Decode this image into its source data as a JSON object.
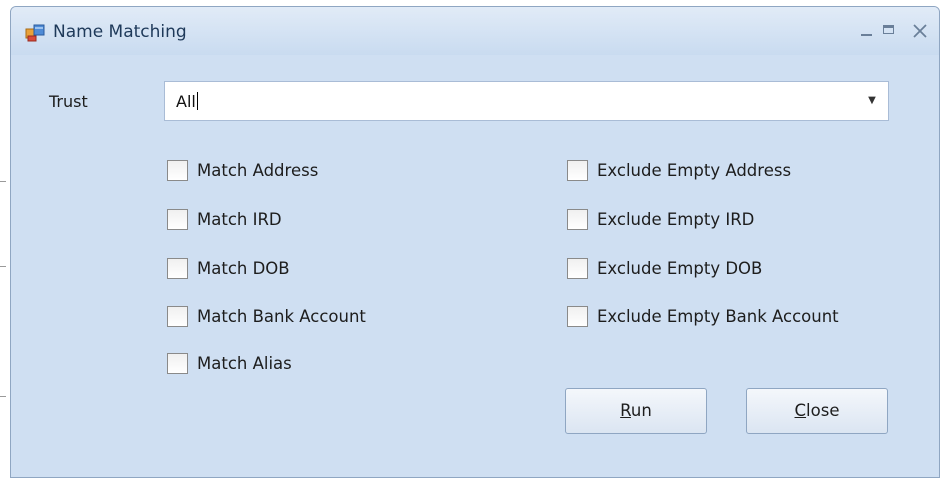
{
  "window": {
    "title": "Name Matching"
  },
  "background": {
    "fragment_text": "Trust"
  },
  "trust": {
    "label": "Trust",
    "value": "All"
  },
  "match_options": [
    {
      "label": "Match Address",
      "checked": false
    },
    {
      "label": "Match IRD",
      "checked": false
    },
    {
      "label": "Match DOB",
      "checked": false
    },
    {
      "label": "Match Bank Account",
      "checked": false
    },
    {
      "label": "Match Alias",
      "checked": false
    }
  ],
  "exclude_options": [
    {
      "label": "Exclude Empty Address",
      "checked": false
    },
    {
      "label": "Exclude Empty IRD",
      "checked": false
    },
    {
      "label": "Exclude Empty DOB",
      "checked": false
    },
    {
      "label": "Exclude Empty Bank Account",
      "checked": false
    }
  ],
  "buttons": {
    "run": {
      "mnemonic": "R",
      "rest": "un"
    },
    "close": {
      "mnemonic": "C",
      "rest": "lose"
    }
  },
  "icons": {
    "app": "app-window-icon",
    "minimize": "minimize-icon",
    "maximize": "maximize-icon",
    "close": "close-icon",
    "dropdown": "chevron-down-icon"
  }
}
